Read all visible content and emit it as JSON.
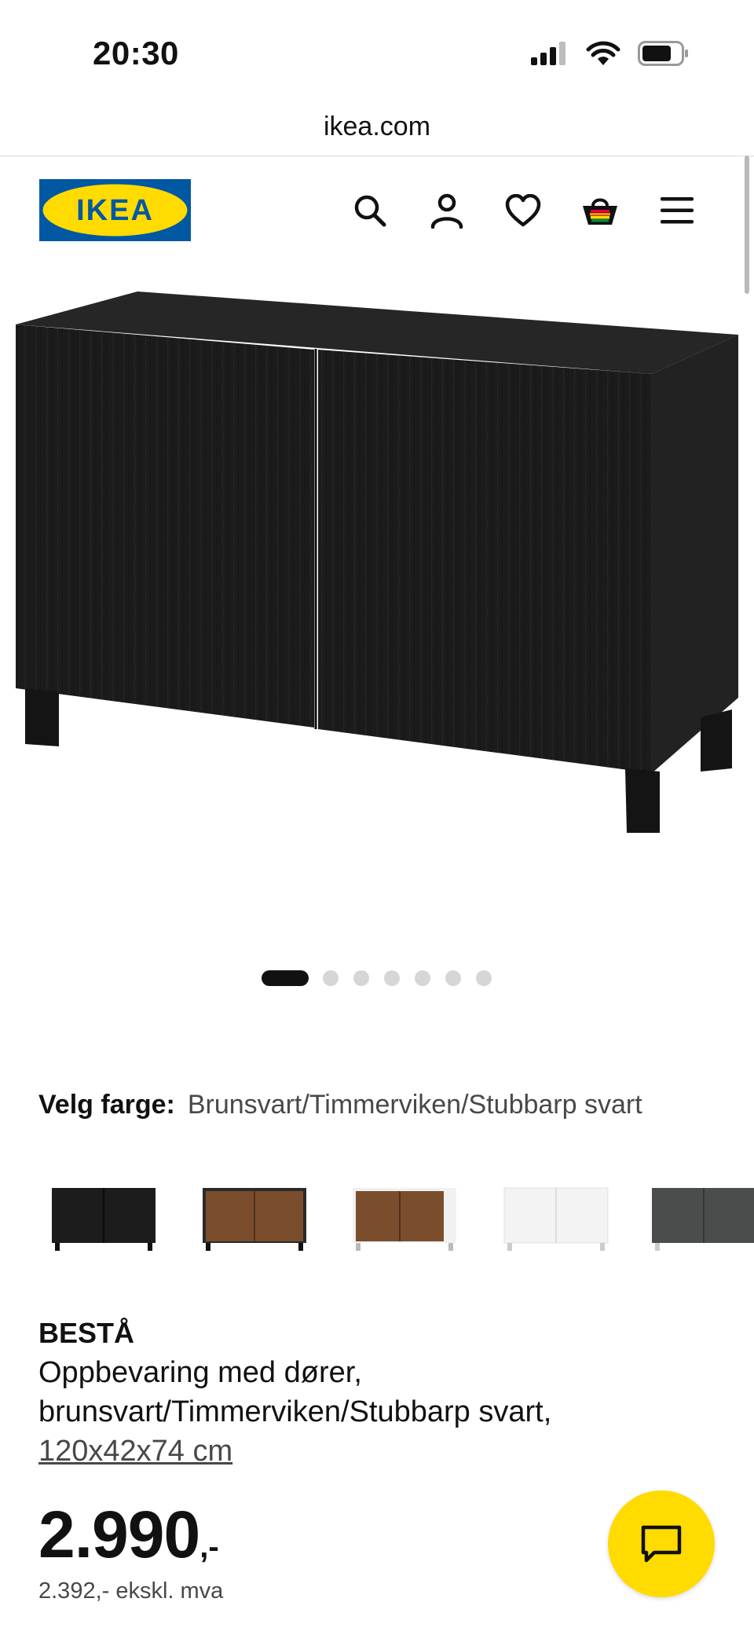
{
  "status_bar": {
    "time": "20:30",
    "icons": [
      "signal-icon",
      "wifi-icon",
      "battery-icon"
    ]
  },
  "browser": {
    "url": "ikea.com"
  },
  "header": {
    "logo_text": "IKEA",
    "icons": [
      "search-icon",
      "account-icon",
      "wishlist-heart-icon",
      "shopping-bag-icon",
      "menu-icon"
    ]
  },
  "gallery": {
    "image_count": 7,
    "active_index": 0
  },
  "color_selector": {
    "label": "Velg farge:",
    "value": "Brunsvart/Timmerviken/Stubbarp svart",
    "options": [
      "black-brown",
      "black-brown/walnut",
      "white/walnut",
      "white",
      "dark grey"
    ]
  },
  "product": {
    "name": "BESTÅ",
    "description": "Oppbevaring med dører, brunsvart/Timmerviken/Stubbarp svart,",
    "size_link": "120x42x74 cm",
    "price_main": "2.990",
    "price_suffix": ",-",
    "price_ex_vat": "2.392,- ekskl. mva"
  },
  "colors": {
    "brand_blue": "#0058a3",
    "brand_yellow": "#ffdb00",
    "text": "#111111",
    "muted": "#484848"
  }
}
